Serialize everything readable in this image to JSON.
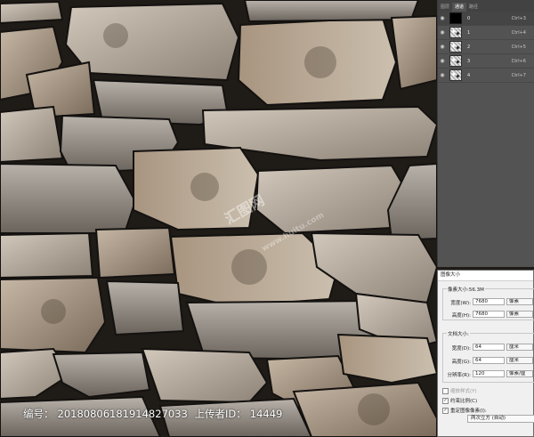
{
  "channels_panel": {
    "tabs": [
      "图层",
      "通道",
      "路径"
    ],
    "active_tab": 1,
    "rows": [
      {
        "name": "0",
        "shortcut": "Ctrl+3",
        "thumb": "black",
        "selected": true
      },
      {
        "name": "1",
        "shortcut": "Ctrl+4",
        "thumb": "texture",
        "selected": false
      },
      {
        "name": "2",
        "shortcut": "Ctrl+5",
        "thumb": "texture",
        "selected": false
      },
      {
        "name": "3",
        "shortcut": "Ctrl+6",
        "thumb": "texture",
        "selected": false
      },
      {
        "name": "4",
        "shortcut": "Ctrl+7",
        "thumb": "texture",
        "selected": false
      }
    ]
  },
  "image_size_dialog": {
    "title": "图像大小",
    "pixel_dimensions_label": "像素大小:56.3M",
    "width_label": "宽度(W):",
    "width_value": "7680",
    "width_unit": "像素",
    "height_label": "高度(H):",
    "height_value": "7680",
    "height_unit": "像素",
    "document_size_label": "文档大小:",
    "doc_width_label": "宽度(D):",
    "doc_width_value": "64",
    "doc_width_unit": "厘米",
    "doc_height_label": "高度(G):",
    "doc_height_value": "64",
    "doc_height_unit": "厘米",
    "resolution_label": "分辨率(R):",
    "resolution_value": "120",
    "resolution_unit": "像素/厘",
    "scale_styles_label": "缩放样式(Y)",
    "constrain_label": "约束比例(C)",
    "resample_label": "重定图像像素(I):",
    "resample_method": "两次立方 (自动)"
  },
  "watermark": {
    "text": "汇图网",
    "url_text": "www.huitu.com"
  },
  "footer": {
    "id_label": "编号：",
    "id_value": "20180806181914827033",
    "uploader_label": "上传者ID：",
    "uploader_value": "14449"
  },
  "colors": {
    "panel_bg": "#535353",
    "dialog_bg": "#f0f0f0",
    "stone_light": "#b9aea2",
    "stone_dark": "#6f665d",
    "mortar": "#1f1b17"
  }
}
